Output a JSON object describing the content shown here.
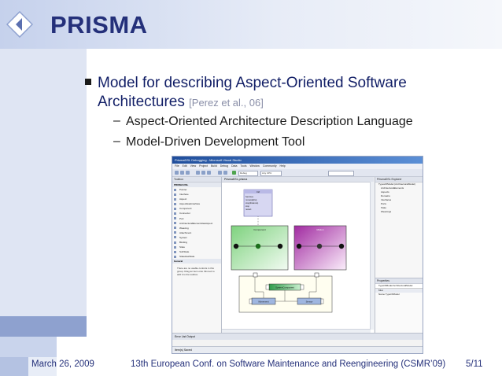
{
  "slide": {
    "title": "PRISMA",
    "bullet": {
      "text": "Model for describing Aspect-Oriented Software Architectures",
      "citation": "[Perez et al., 06]"
    },
    "subbullets": [
      {
        "dash": "–",
        "text": "Aspect-Oriented Architecture Description Language"
      },
      {
        "dash": "–",
        "text": "Model-Driven Development Tool"
      }
    ]
  },
  "footer": {
    "date": "March 26, 2009",
    "conference": "13th European Conf. on Software Maintenance and Reengineering  (CSMR’09)",
    "page": "5/11"
  },
  "screenshot": {
    "window_title": "PrismaDSL Debugging - Microsoft Visual Studio",
    "menu": "File  Edit  View  Project  Build  Debug  Data  Tools  Window  Community  Help",
    "config": "Debug",
    "platform": "Any CPU",
    "toolbox_title": "Toolbox",
    "toolbox_group": "PRISMA DSL",
    "toolbox_items": [
      "Pointer",
      "Interface",
      "Aspect",
      "AspectHasInterface",
      "Component",
      "Connector",
      "Port",
      "ArchitecturalElementHasAspect",
      "Weaving",
      "Attachment",
      "System",
      "Binding",
      "State",
      "SubState",
      "StateHasState"
    ],
    "toolbox_general": "General",
    "toolbox_message": "There are no usable controls in this group. Drag an item onto this text to add it to the toolbox.",
    "document_tab": "PrismaDSL.prisma",
    "explorer_title": "PrismaDSL Explorer",
    "explorer_items": [
      "TypesOfModel (ArchitecturalModel)",
      "ArchitecturalElements",
      "Aspects",
      "Domains",
      "Interfaces",
      "Ports",
      "State",
      "Weavings"
    ],
    "properties_title": "Properties",
    "properties_object": "TypeOfModel  ArchitecturalModel",
    "properties_rows": [
      "Misc",
      "Name   TypeOfModel"
    ],
    "bottom_tabs": "Error List   Output",
    "status": "Item(s) Saved",
    "diagram": {
      "interface_title": "Intf",
      "interface_rows": [
        "Services",
        "move(alpha)",
        "stop(distance)",
        "stop",
        "restart"
      ],
      "component_left": "Component",
      "component_right": "Motion",
      "system_label": "SystemComponent",
      "small_left": "Movement",
      "small_right": "Sensor"
    },
    "colors": {
      "left_aspect": "#7ed27e",
      "right_aspect": "#a02aa0",
      "interface": "#d7d7f2"
    }
  },
  "theme": {
    "title_color": "#24307a",
    "band_color": "#c9d4ec"
  }
}
